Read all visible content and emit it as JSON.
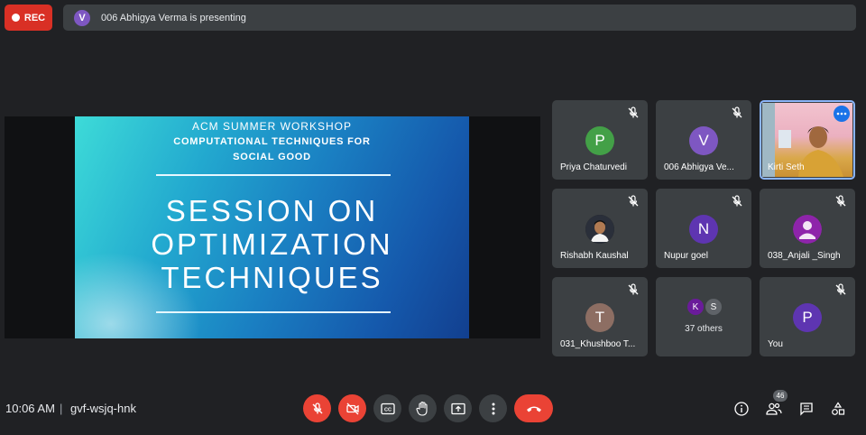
{
  "top_bar": {
    "rec_label": "REC",
    "presenter_initial": "V",
    "presenter_text": "006 Abhigya Verma is presenting"
  },
  "slide": {
    "line1": "ACM SUMMER WORKSHOP",
    "line2": "COMPUTATIONAL TECHNIQUES FOR",
    "line3": "SOCIAL GOOD",
    "title_l1": "SESSION ON",
    "title_l2": "OPTIMIZATION",
    "title_l3": "TECHNIQUES"
  },
  "participants": [
    {
      "initial": "P",
      "name": "Priya Chaturvedi",
      "color": "#43a047"
    },
    {
      "initial": "V",
      "name": "006 Abhigya Ve...",
      "color": "#7e57c2"
    },
    {
      "initial": "",
      "name": "Kirti Seth",
      "color": ""
    },
    {
      "initial": "",
      "name": "Rishabh Kaushal",
      "color": ""
    },
    {
      "initial": "N",
      "name": "Nupur goel",
      "color": "#5e35b1"
    },
    {
      "initial": "",
      "name": "038_Anjali _Singh",
      "color": "#8e24aa"
    },
    {
      "initial": "T",
      "name": "031_Khushboo T...",
      "color": "#8d6e63"
    },
    {
      "initial": "",
      "name": "You",
      "color": "#5e35b1"
    }
  ],
  "others": {
    "k": "K",
    "s": "S",
    "label": "37 others"
  },
  "you_initial": "P",
  "bottom_bar": {
    "time": "10:06 AM",
    "separator": "|",
    "meeting_code": "gvf-wsjq-hnk",
    "people_count": "46"
  }
}
